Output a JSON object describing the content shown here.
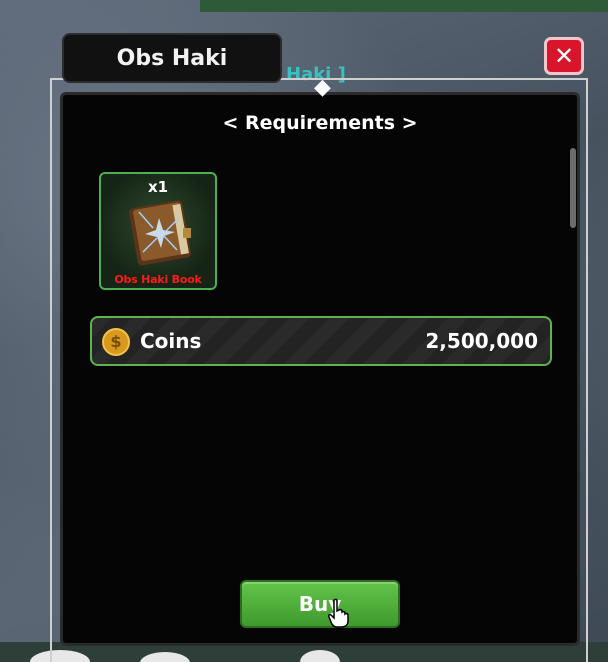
{
  "window": {
    "title": "Obs Haki",
    "background_tag": "Haki ]",
    "close_label": "✕"
  },
  "requirements": {
    "heading": "< Requirements >",
    "item": {
      "quantity": "x1",
      "name": "Obs Haki Book",
      "icon": "book-icon"
    },
    "cost": {
      "currency_label": "Coins",
      "amount": "2,500,000",
      "icon": "coin-icon"
    }
  },
  "actions": {
    "buy_label": "Buy"
  },
  "colors": {
    "accent_green": "#4caf50",
    "close_red": "#d8152a",
    "item_name_red": "#ff1a1a"
  }
}
